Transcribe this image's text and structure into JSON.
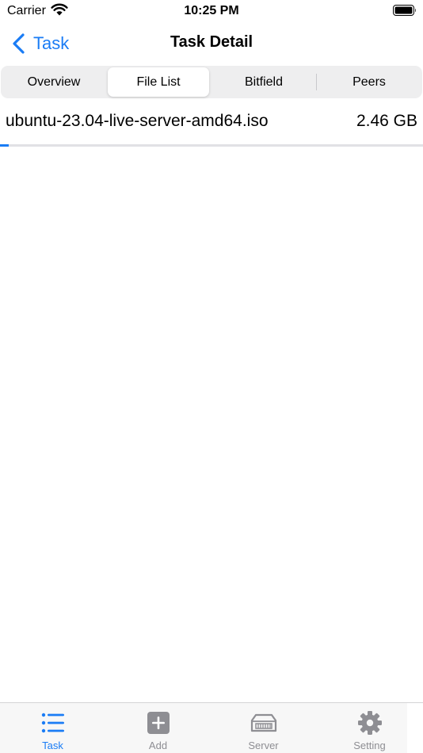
{
  "status_bar": {
    "carrier": "Carrier",
    "time": "10:25 PM"
  },
  "nav": {
    "back_label": "Task",
    "title": "Task Detail"
  },
  "segments": [
    {
      "label": "Overview",
      "selected": false
    },
    {
      "label": "File List",
      "selected": true
    },
    {
      "label": "Bitfield",
      "selected": false
    },
    {
      "label": "Peers",
      "selected": false
    }
  ],
  "files": [
    {
      "name": "ubuntu-23.04-live-server-amd64.iso",
      "size": "2.46 GB",
      "progress": 0.02
    }
  ],
  "tab_bar": {
    "items": [
      {
        "label": "Task",
        "icon": "list-icon",
        "active": true
      },
      {
        "label": "Add",
        "icon": "plus-square-icon",
        "active": false
      },
      {
        "label": "Server",
        "icon": "server-icon",
        "active": false
      },
      {
        "label": "Setting",
        "icon": "gear-icon",
        "active": false
      }
    ]
  },
  "colors": {
    "accent": "#1a7cf5",
    "inactive": "#8e8e93"
  }
}
